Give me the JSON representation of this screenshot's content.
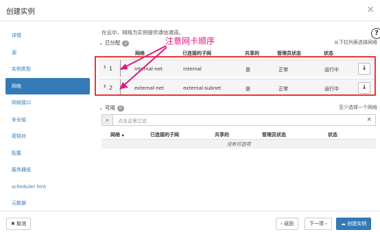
{
  "modal": {
    "title": "创建实例",
    "close_glyph": "×"
  },
  "sidebar": {
    "items": [
      {
        "label": "详情"
      },
      {
        "label": "源"
      },
      {
        "label": "实例类型"
      },
      {
        "label": "网络",
        "active": true
      },
      {
        "label": "网络接口"
      },
      {
        "label": "安全组"
      },
      {
        "label": "密钥对"
      },
      {
        "label": "配置"
      },
      {
        "label": "服务器组"
      },
      {
        "label": "scheduler hint"
      },
      {
        "label": "元数据"
      }
    ]
  },
  "main": {
    "description": "在云中，网络为实例提供通信通道。",
    "help_glyph": "?",
    "allocated": {
      "label": "已分配",
      "count": "2",
      "hint": "从下拉列表选择网络"
    },
    "columns": {
      "network": "网络",
      "subnet": "已连接的子网",
      "shared": "共享的",
      "admin_state": "管理员状态",
      "status": "状态"
    },
    "allocated_rows": [
      {
        "order": "1",
        "network": "internal-net",
        "subnet": "internal",
        "shared": "是",
        "admin_state": "正常",
        "status": "运行中"
      },
      {
        "order": "2",
        "network": "external-net",
        "subnet": "external-subnet",
        "shared": "是",
        "admin_state": "正常",
        "status": "运行中"
      }
    ],
    "available": {
      "label": "可用",
      "count": "0",
      "hint": "至少选择一个网络"
    },
    "filter_placeholder": "点击这里过滤",
    "available_columns": {
      "network": "网络 ▴",
      "subnet": "已连接的子网",
      "shared": "共享的",
      "admin_state": "管理员状态",
      "status": "状态"
    },
    "empty_text": "没有可选项"
  },
  "annotation": {
    "text": "注意网卡顺序",
    "color": "#e0177f"
  },
  "footer": {
    "cancel": "✖ 取消",
    "back": "‹ 返回",
    "next": "下一项 ›",
    "create": "创建实例"
  },
  "colors": {
    "accent": "#337ab7",
    "frame": "#e33333"
  }
}
